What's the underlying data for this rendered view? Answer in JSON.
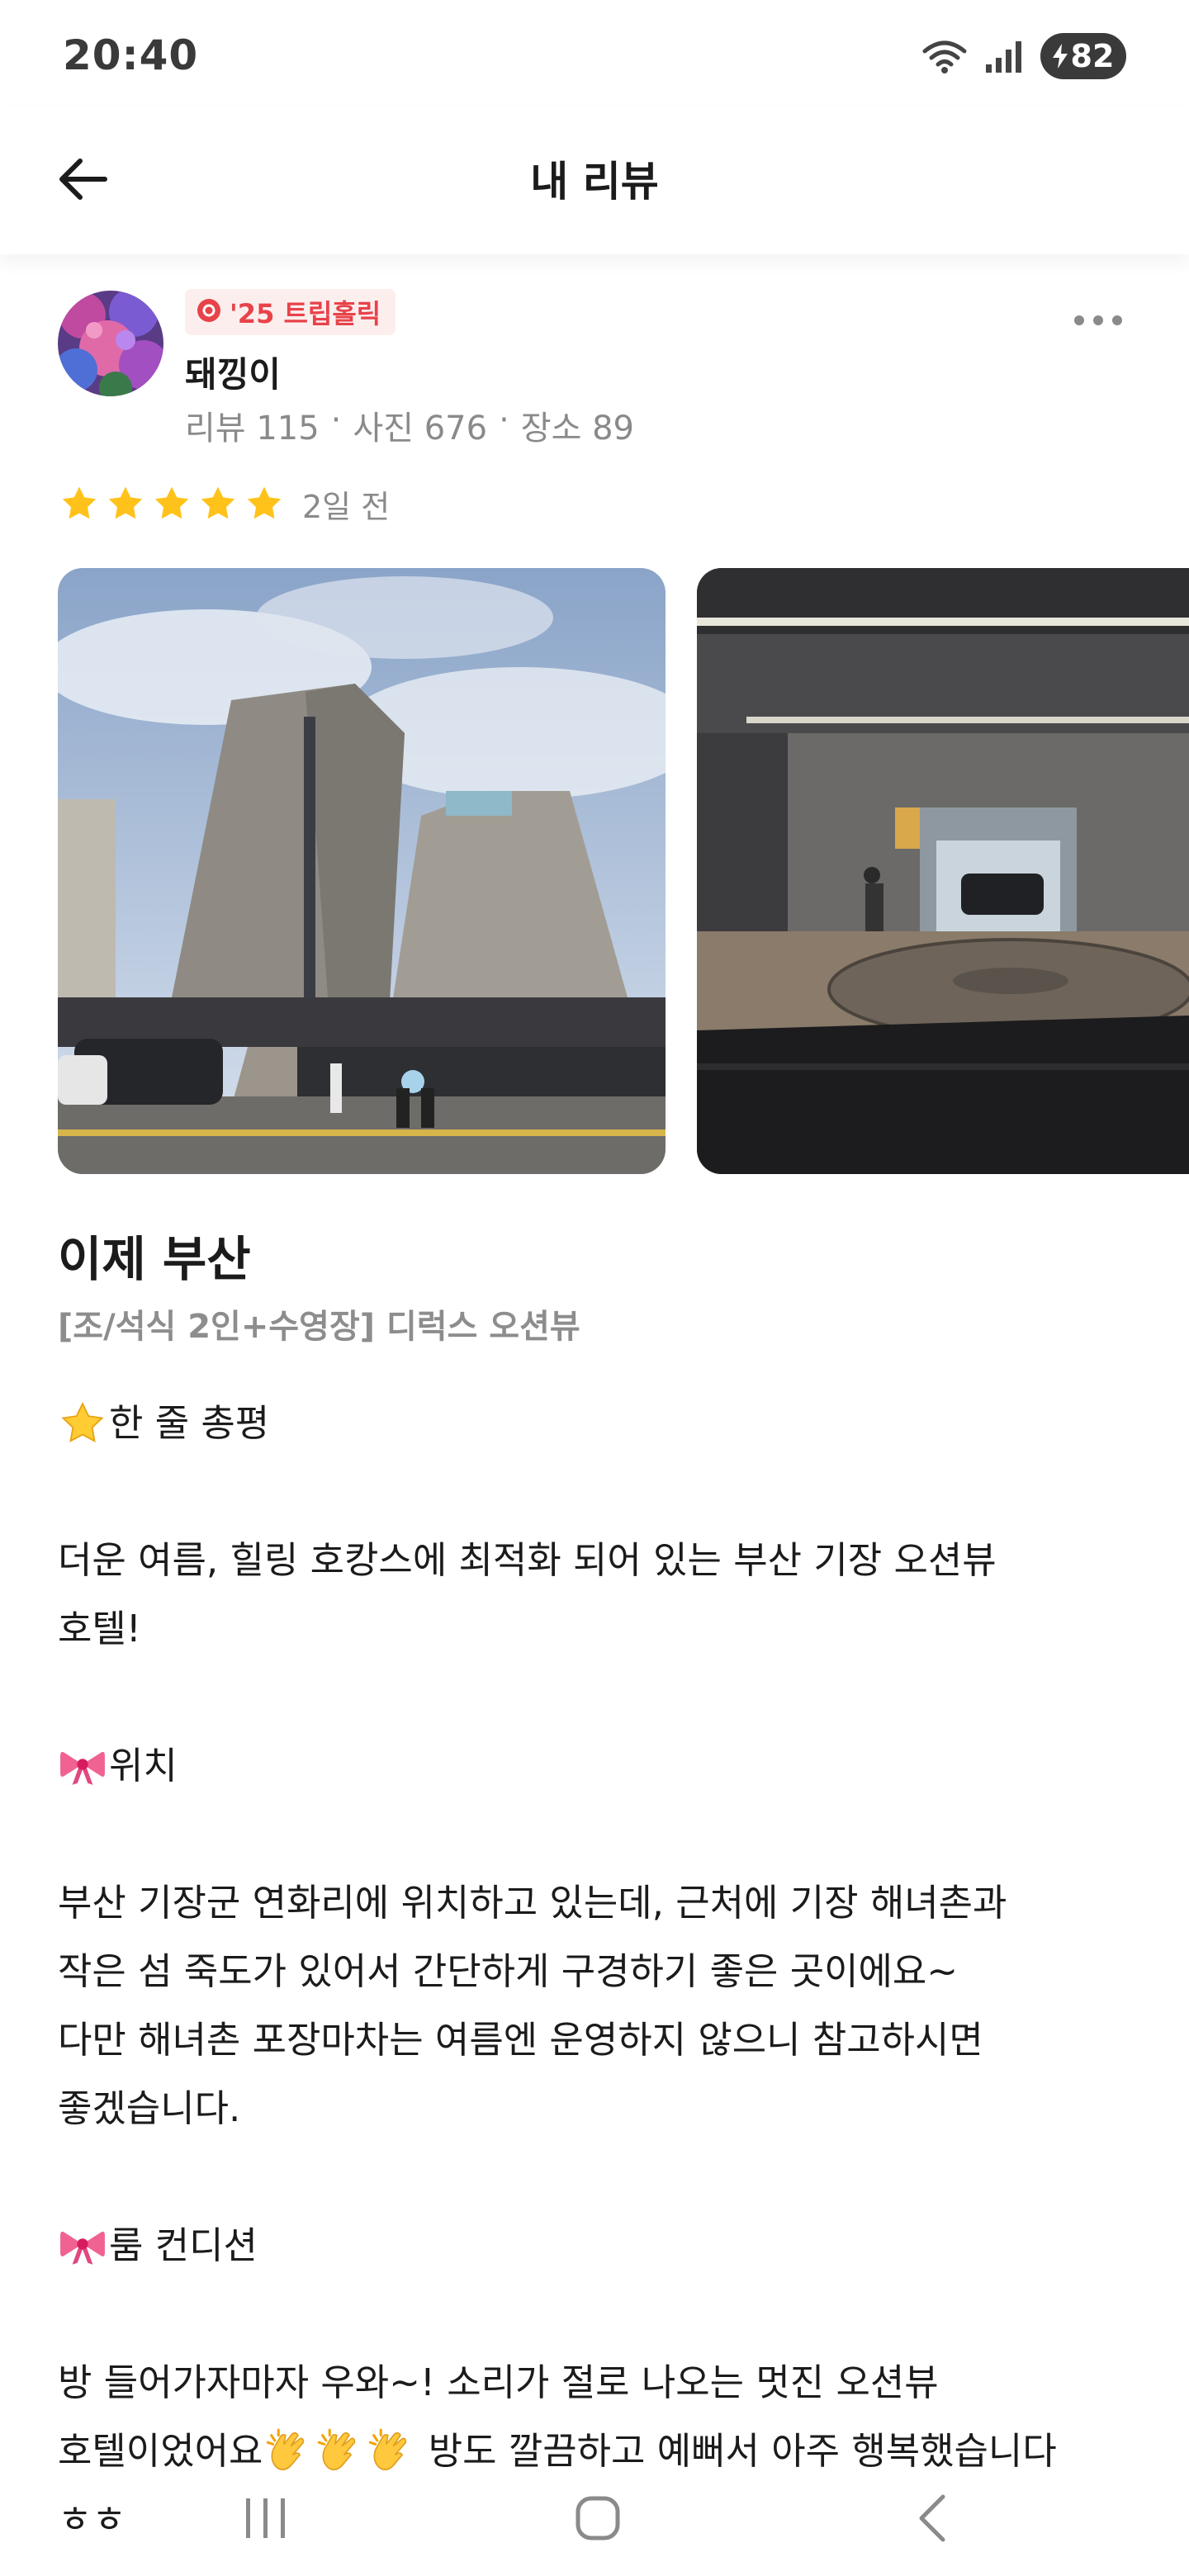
{
  "status_bar": {
    "time": "20:40",
    "battery": "82"
  },
  "header": {
    "title": "내 리뷰"
  },
  "reviewer": {
    "badge": "'25 트립홀릭",
    "name": "돼낑이",
    "stats": [
      "리뷰 115",
      "·",
      "사진 676",
      "·",
      "장소 89"
    ]
  },
  "review": {
    "rating": 5,
    "date": "2일 전",
    "place": "이제 부산",
    "room": "[조/석식 2인+수영장] 디럭스 오션뷰",
    "lines": [
      {
        "emoji": "star",
        "text": "한 줄 총평"
      },
      {
        "text": ""
      },
      {
        "text": "더운 여름, 힐링 호캉스에 최적화 되어 있는 부산 기장 오션뷰"
      },
      {
        "text": "호텔!"
      },
      {
        "text": ""
      },
      {
        "emoji": "ribbon",
        "text": "위치"
      },
      {
        "text": ""
      },
      {
        "text": "부산 기장군 연화리에 위치하고 있는데, 근처에 기장 해녀촌과"
      },
      {
        "text": "작은 섬 죽도가 있어서 간단하게 구경하기 좋은 곳이에요~"
      },
      {
        "text": "다만 해녀촌 포장마차는 여름엔 운영하지 않으니 참고하시면"
      },
      {
        "text": "좋겠습니다."
      },
      {
        "text": ""
      },
      {
        "emoji": "ribbon",
        "text": "룸 컨디션"
      },
      {
        "text": ""
      },
      {
        "text": "방 들어가자마자 우와~! 소리가 절로 나오는 멋진 오션뷰"
      },
      {
        "text": "호텔이었어요",
        "after_emoji": "clap3",
        "tail": " 방도 깔끔하고 예뻐서 아주 행복했습니다"
      },
      {
        "text": "ㅎㅎ"
      }
    ]
  },
  "icons": {
    "back": "arrow-left-icon",
    "more": "more-horizontal-icon",
    "star": "star-icon",
    "badge": "flower-badge-icon"
  },
  "colors": {
    "accent": "#e8424a",
    "star": "#ffc21a",
    "muted": "#8a8a8a"
  }
}
